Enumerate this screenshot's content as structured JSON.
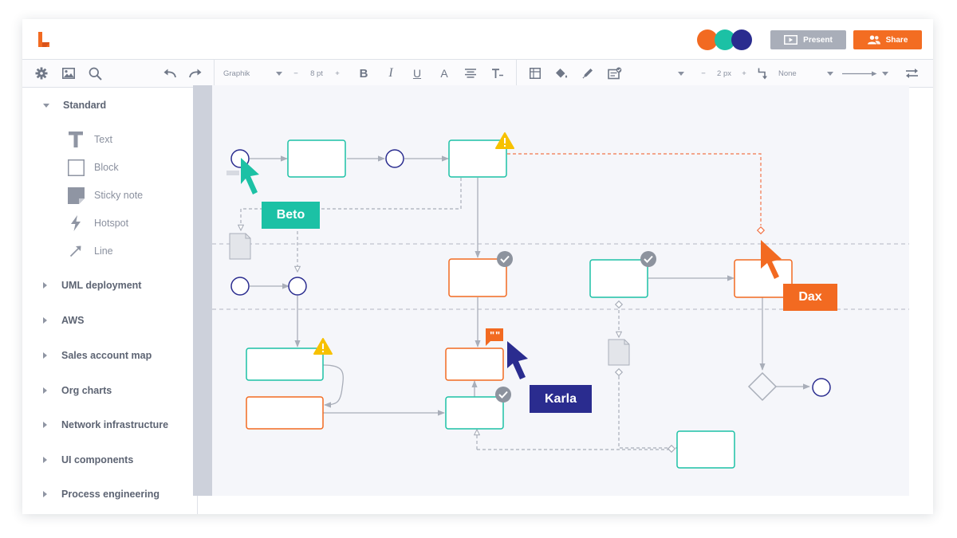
{
  "colors": {
    "teal": "#1cc1a5",
    "orange": "#f26a21",
    "navy": "#2a2c8f",
    "present_btn": "#a9aeb9",
    "share_btn": "#f36d22",
    "lane": "#cdd1db",
    "canvas_bg": "#f5f6fa"
  },
  "toolbar": {
    "font_name": "Graphik",
    "font_size": "8 pt",
    "line_width": "2 px",
    "line_style": "None"
  },
  "header": {
    "present_label": "Present",
    "share_label": "Share",
    "collaborator_colors": [
      "#f26a21",
      "#1cc1a5",
      "#2a2c8f"
    ]
  },
  "sidebar": {
    "open_category": "Standard",
    "shapes": [
      {
        "label": "Text",
        "icon": "text-icon"
      },
      {
        "label": "Block",
        "icon": "block-icon"
      },
      {
        "label": "Sticky note",
        "icon": "sticky-note-icon"
      },
      {
        "label": "Hotspot",
        "icon": "lightning-icon"
      },
      {
        "label": "Line",
        "icon": "line-arrow-icon"
      }
    ],
    "categories": [
      "UML deployment",
      "AWS",
      "Sales account map",
      "Org charts",
      "Network infrastructure",
      "UI components",
      "Process engineering"
    ]
  },
  "cursors": {
    "beto": "Beto",
    "karla": "Karla",
    "dax": "Dax"
  }
}
